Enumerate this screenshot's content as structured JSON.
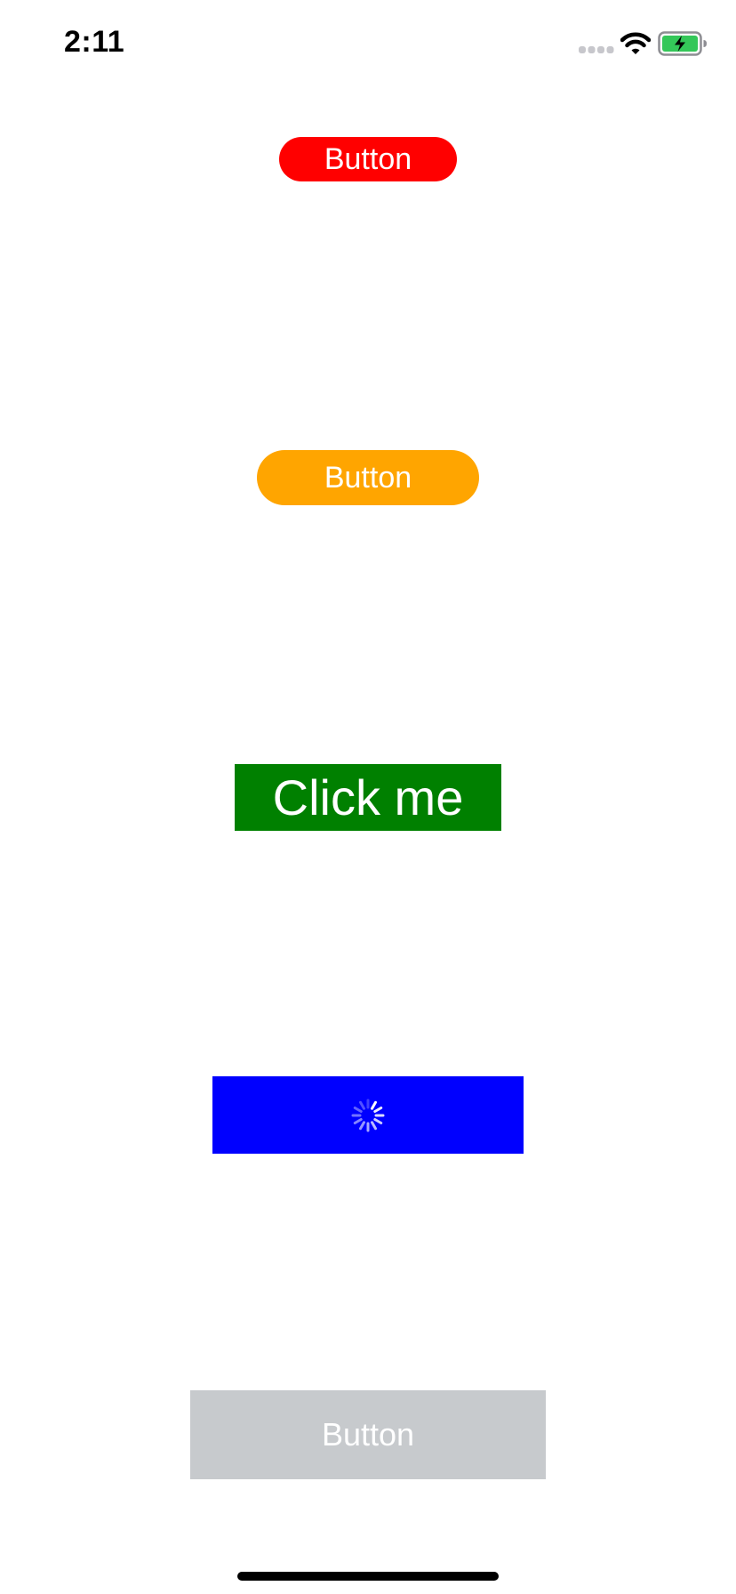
{
  "status_bar": {
    "time": "2:11",
    "icons": [
      "cellular-signal-icon",
      "wifi-icon",
      "battery-charging-icon"
    ]
  },
  "buttons": {
    "red": {
      "label": "Button",
      "color": "#ff0000"
    },
    "orange": {
      "label": "Button",
      "color": "#ffa500"
    },
    "green": {
      "label": "Click me",
      "color": "#008000"
    },
    "blue": {
      "color": "#0000ff",
      "state": "loading",
      "icon": "activity-spinner-icon"
    },
    "gray": {
      "label": "Button",
      "color": "#c7cacd",
      "state": "disabled"
    }
  },
  "colors": {
    "battery_fill": "#34c759",
    "background": "#ffffff"
  }
}
